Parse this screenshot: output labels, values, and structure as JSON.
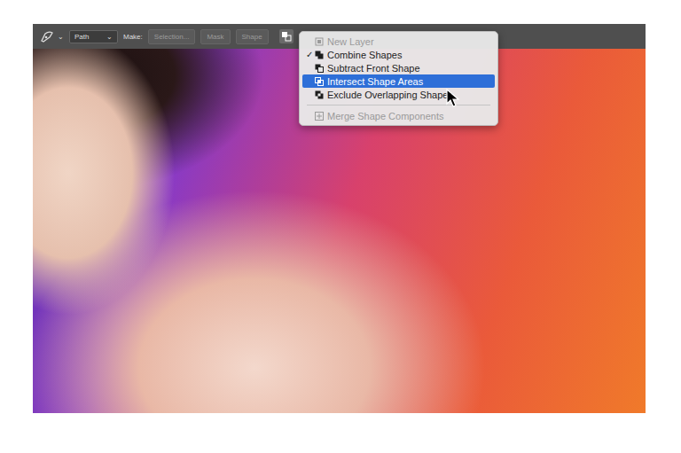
{
  "toolbar": {
    "tool_arrow": "⌄",
    "mode": {
      "value": "Path",
      "arrow": "⌄"
    },
    "make_label": "Make:",
    "buttons": [
      {
        "label": "Selection...",
        "disabled": true
      },
      {
        "label": "Mask",
        "disabled": true
      },
      {
        "label": "Shape",
        "disabled": true
      }
    ]
  },
  "menu": {
    "groups": [
      [
        {
          "label": "New Layer",
          "checked": false,
          "disabled": true,
          "selected": false
        },
        {
          "label": "Combine Shapes",
          "checked": true,
          "disabled": false,
          "selected": false
        },
        {
          "label": "Subtract Front Shape",
          "checked": false,
          "disabled": false,
          "selected": false
        },
        {
          "label": "Intersect Shape Areas",
          "checked": false,
          "disabled": false,
          "selected": true
        },
        {
          "label": "Exclude Overlapping Shapes",
          "checked": false,
          "disabled": false,
          "selected": false
        }
      ],
      [
        {
          "label": "Merge Shape Components",
          "checked": false,
          "disabled": true,
          "selected": false
        }
      ]
    ],
    "check_mark": "✓"
  }
}
